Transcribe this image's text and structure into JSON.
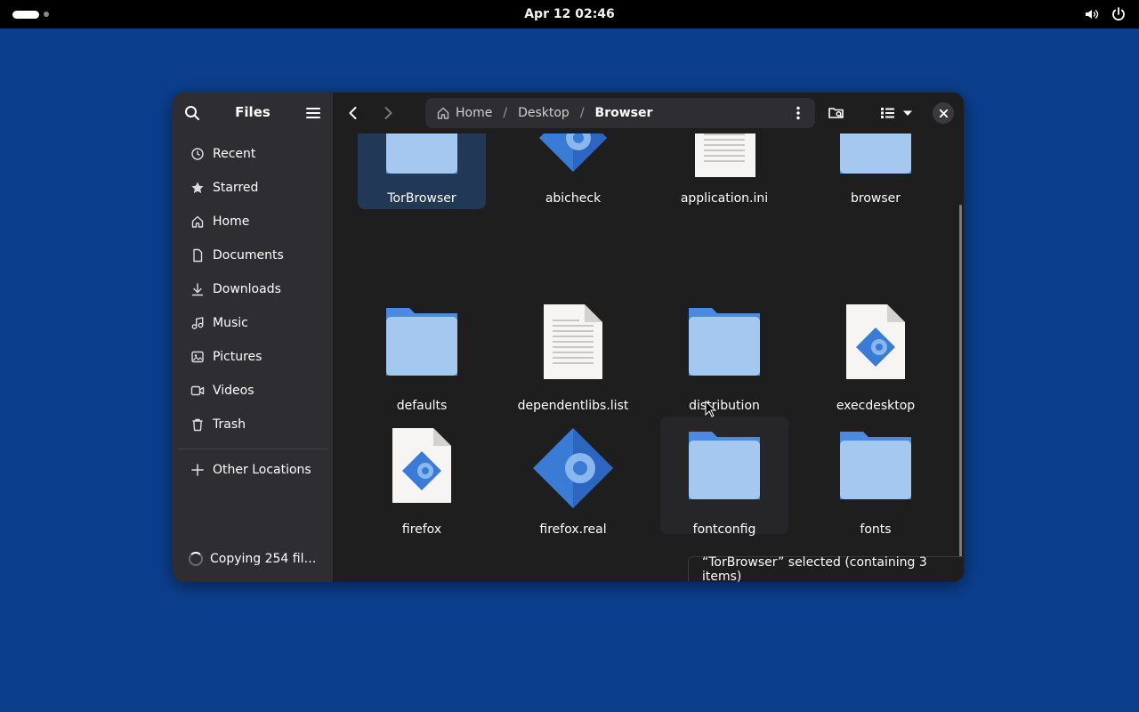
{
  "topbar": {
    "clock": "Apr 12  02:46"
  },
  "sidebar": {
    "title": "Files",
    "items": [
      {
        "label": "Recent",
        "icon": "clock-icon"
      },
      {
        "label": "Starred",
        "icon": "star-icon"
      },
      {
        "label": "Home",
        "icon": "home-icon"
      },
      {
        "label": "Documents",
        "icon": "document-icon"
      },
      {
        "label": "Downloads",
        "icon": "download-icon"
      },
      {
        "label": "Music",
        "icon": "music-icon"
      },
      {
        "label": "Pictures",
        "icon": "picture-icon"
      },
      {
        "label": "Videos",
        "icon": "video-icon"
      },
      {
        "label": "Trash",
        "icon": "trash-icon"
      }
    ],
    "other_locations": "Other Locations",
    "progress": "Copying 254 fil…"
  },
  "pathbar": {
    "home": "Home",
    "desktop": "Desktop",
    "current": "Browser",
    "separator": "/"
  },
  "files": [
    {
      "name": "TorBrowser",
      "kind": "folder",
      "selected": true
    },
    {
      "name": "abicheck",
      "kind": "executable"
    },
    {
      "name": "application.ini",
      "kind": "text"
    },
    {
      "name": "browser",
      "kind": "folder"
    },
    {
      "name": "defaults",
      "kind": "folder"
    },
    {
      "name": "dependentlibs.list",
      "kind": "text"
    },
    {
      "name": "distribution",
      "kind": "folder"
    },
    {
      "name": "execdesktop",
      "kind": "script"
    },
    {
      "name": "firefox",
      "kind": "script"
    },
    {
      "name": "firefox.real",
      "kind": "executable"
    },
    {
      "name": "fontconfig",
      "kind": "folder",
      "hover": true
    },
    {
      "name": "fonts",
      "kind": "folder"
    }
  ],
  "status": "“TorBrowser” selected  (containing 3 items)",
  "colors": {
    "desktop": "#0b3f8e",
    "folder_back": "#4a8ae0",
    "folder_front": "#a4c8f0",
    "selected": "#213956"
  }
}
